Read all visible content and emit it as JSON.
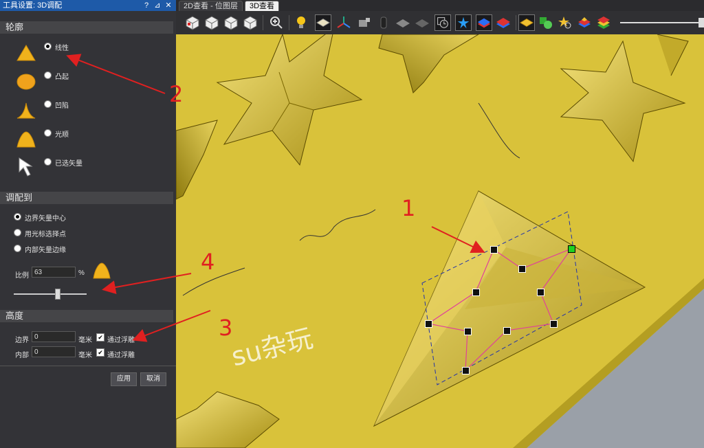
{
  "panel": {
    "title": "工具设置: 3D调配",
    "title_buttons": [
      "?",
      "⊿",
      "✕"
    ],
    "sections": {
      "contour": "轮廓",
      "fit_to": "调配到",
      "height": "高度"
    },
    "contour_options": [
      "线性",
      "凸起",
      "凹陷",
      "光顺",
      "已选矢量"
    ],
    "contour_selected": "线性",
    "fit_options": [
      "边界矢量中心",
      "用光标选择点",
      "内部矢量边缘"
    ],
    "fit_selected": "边界矢量中心",
    "scale_label": "比例",
    "scale_value": "63",
    "scale_unit": "%",
    "slider_level": 0.6,
    "boundary_label": "边界",
    "boundary_value": "0",
    "inner_label": "内部",
    "inner_value": "0",
    "unit_mm": "毫米",
    "pass_relief": "通过浮雕",
    "apply_label": "应用",
    "cancel_label": "取消"
  },
  "tabs": [
    "2D查看 - 位图层",
    "3D查看"
  ],
  "active_tab": "3D查看",
  "annotations": [
    "1",
    "2",
    "3",
    "4"
  ],
  "watermark": "su杂玩",
  "colors": {
    "relief": "#d9c23a",
    "panel": "#333337",
    "title_bar": "#1e5aa8",
    "annotation": "#e02020",
    "node_path": "#e0409a"
  }
}
